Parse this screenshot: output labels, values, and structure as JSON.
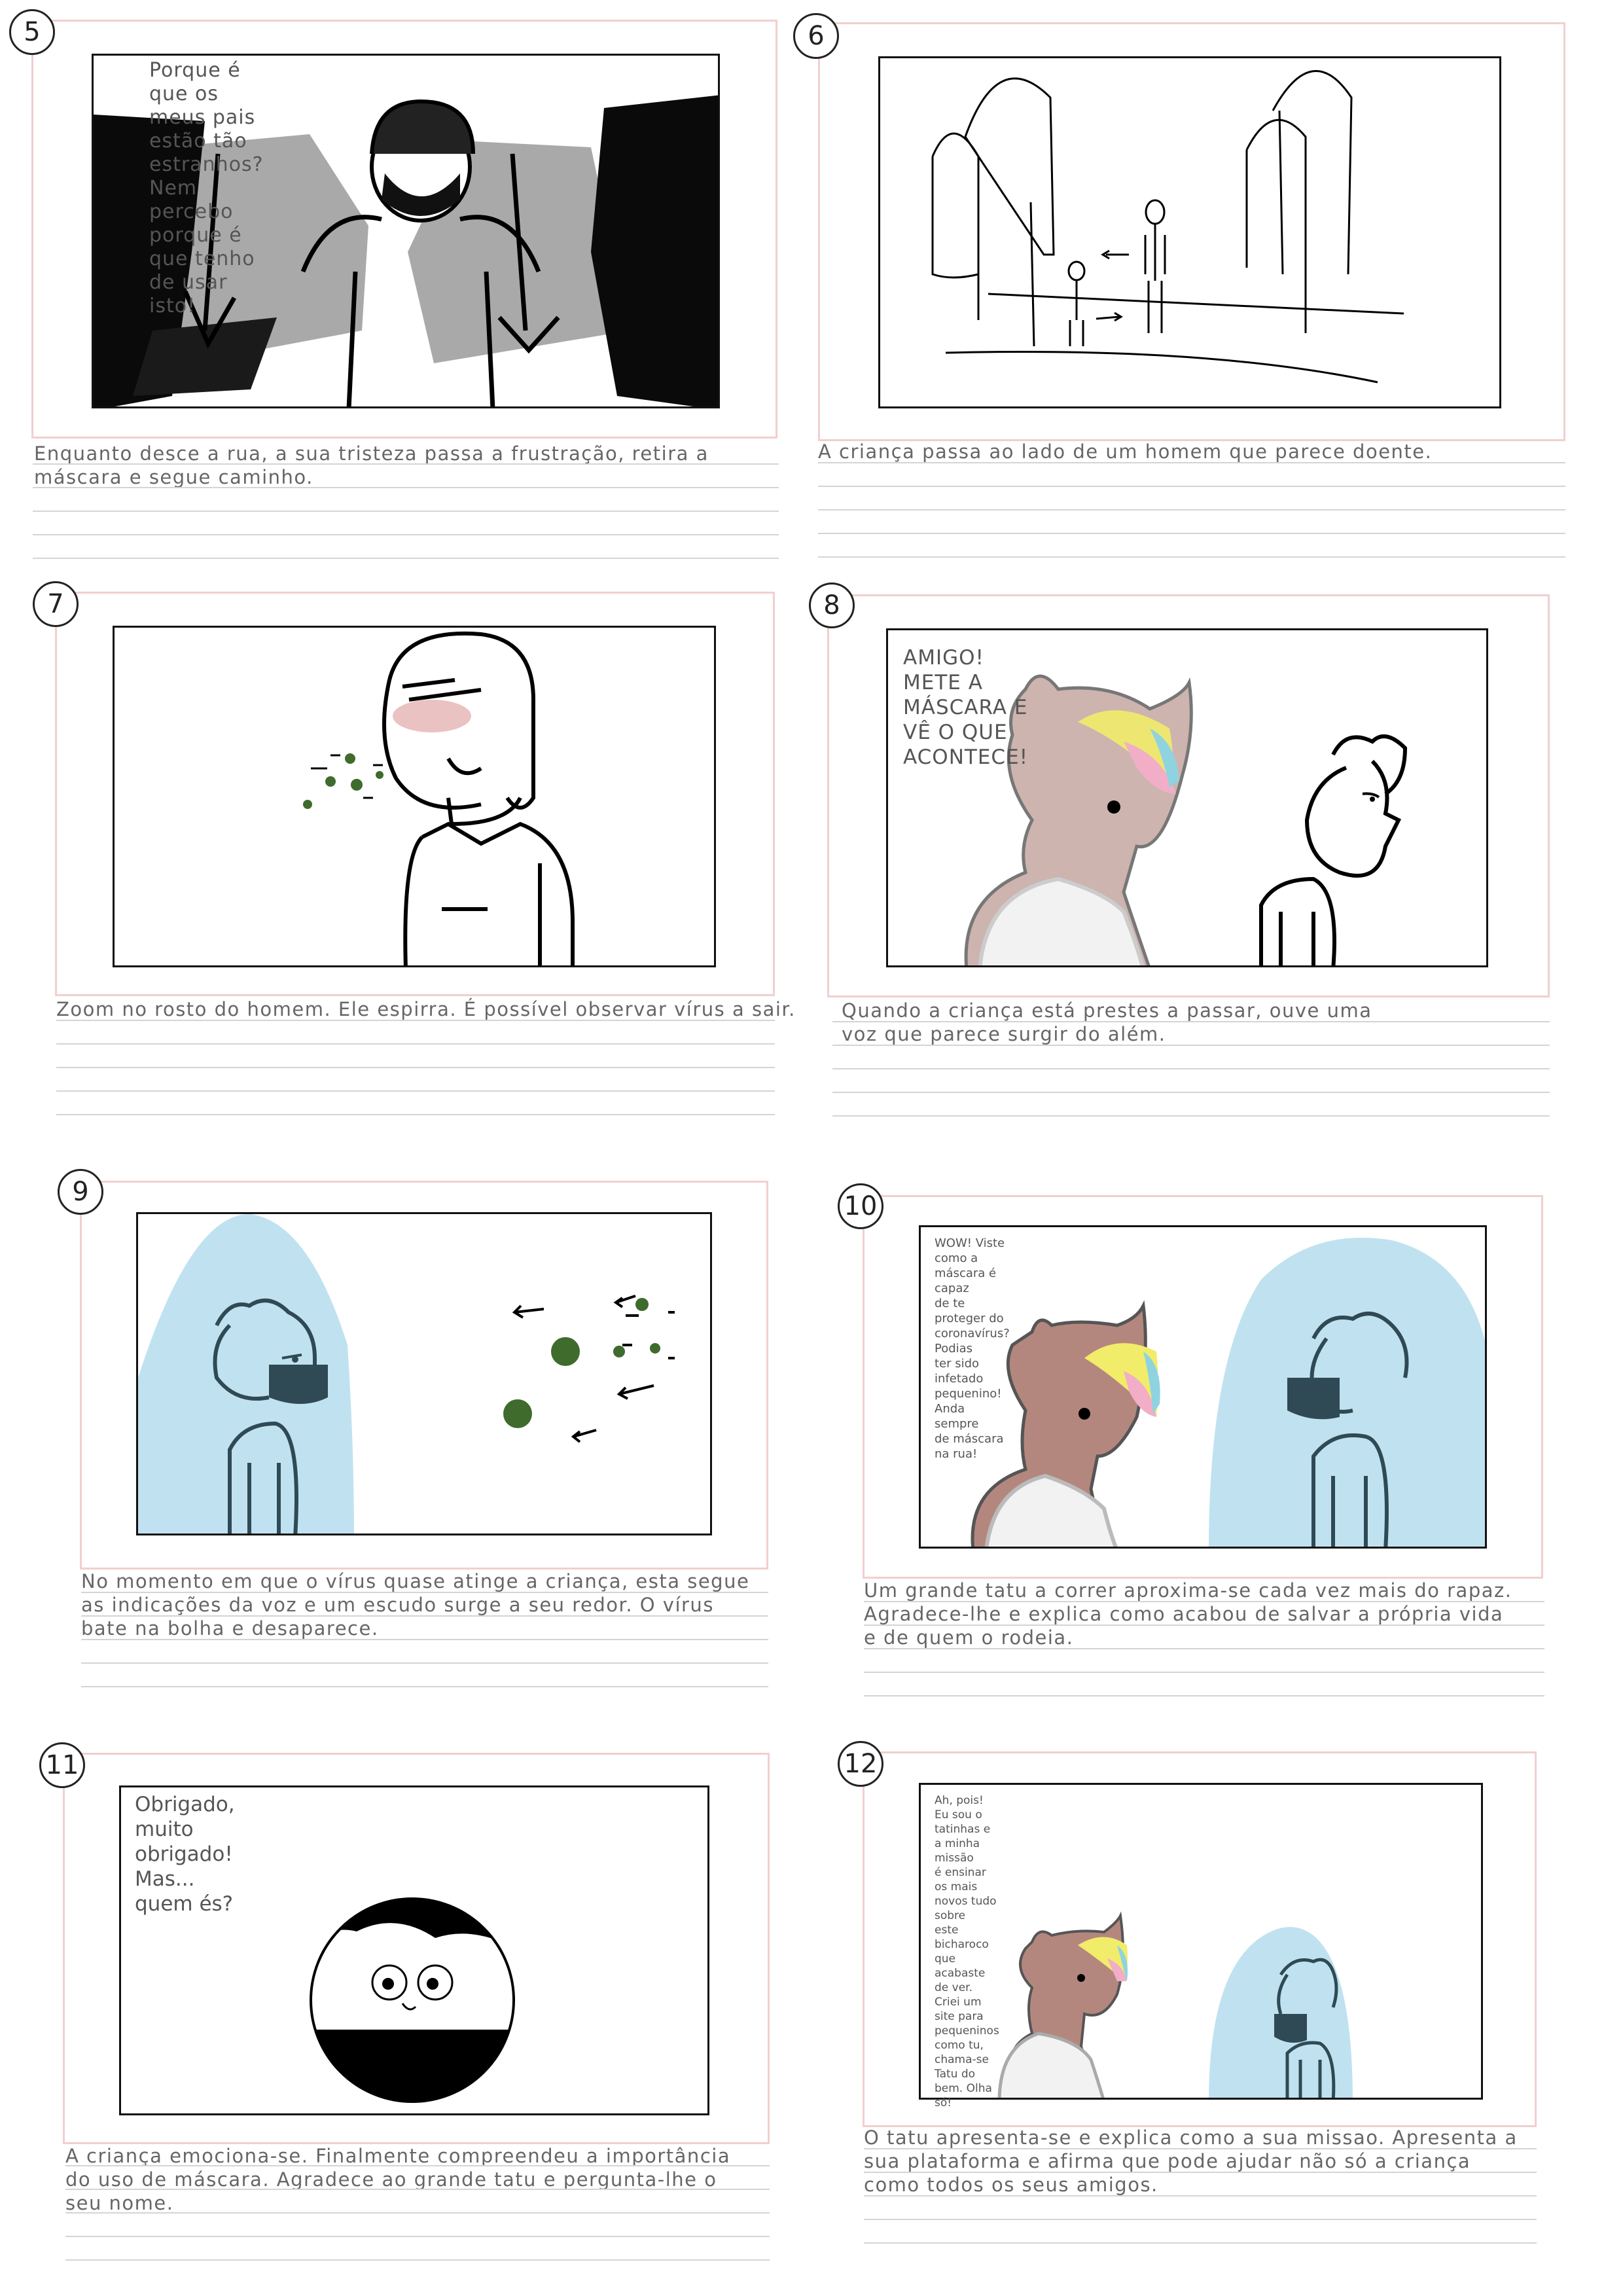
{
  "colors": {
    "panel_border": "#f1cfcf",
    "frame_border": "#111111",
    "caption_text": "#666666",
    "shield_blue": "#b9dfee",
    "virus_green": "#3f6b2c",
    "armadillo_brown": "#b4877e",
    "mask_dark": "#2f4a55"
  },
  "panels": [
    {
      "number": "5",
      "speech": "Porque é que os meus pais estão tão estranhos?\nNem percebo porque é que tenho de usar isto!",
      "caption": "Enquanto desce a rua, a sua tristeza passa a frustração, retira a\nmáscara e segue caminho."
    },
    {
      "number": "6",
      "speech": "",
      "caption": "A criança passa ao lado de um homem que parece doente."
    },
    {
      "number": "7",
      "speech": "",
      "caption": "Zoom no rosto do homem. Ele espirra. É possível observar vírus a sair."
    },
    {
      "number": "8",
      "speech": "AMIGO! METE A MÁSCARA E\nVÊ O QUE ACONTECE!",
      "caption": "Quando a criança está prestes a passar, ouve uma\nvoz que parece surgir do além."
    },
    {
      "number": "9",
      "speech": "",
      "caption": "No momento em que o vírus quase atinge a criança, esta segue\nas indicações da voz e um escudo surge a seu redor. O vírus\nbate na bolha e desaparece."
    },
    {
      "number": "10",
      "speech": "WOW! Viste como a máscara é capaz\nde te proteger do coronavírus? Podias\nter sido infetado pequenino! Anda sempre\nde máscara na rua!",
      "caption": "Um grande tatu a correr aproxima-se cada vez mais do rapaz.\nAgradece-lhe e explica como acabou de salvar a própria vida\ne de quem o rodeia."
    },
    {
      "number": "11",
      "speech": "Obrigado, muito obrigado!\nMas... quem és?",
      "caption": "A criança emociona-se. Finalmente compreendeu a importância\ndo uso de máscara. Agradece ao grande tatu e pergunta-lhe o\nseu nome."
    },
    {
      "number": "12",
      "speech": "Ah, pois!\nEu sou o tatinhas e a minha missão\né ensinar os mais novos tudo sobre\neste bicharoco que acabaste de ver.\nCriei um site para pequeninos como tu,\nchama-se Tatu do bem.  Olha só!",
      "caption": "O tatu apresenta-se e explica como a sua missao. Apresenta a\nsua plataforma e afirma que pode ajudar não só a criança\ncomo todos os seus amigos."
    }
  ]
}
